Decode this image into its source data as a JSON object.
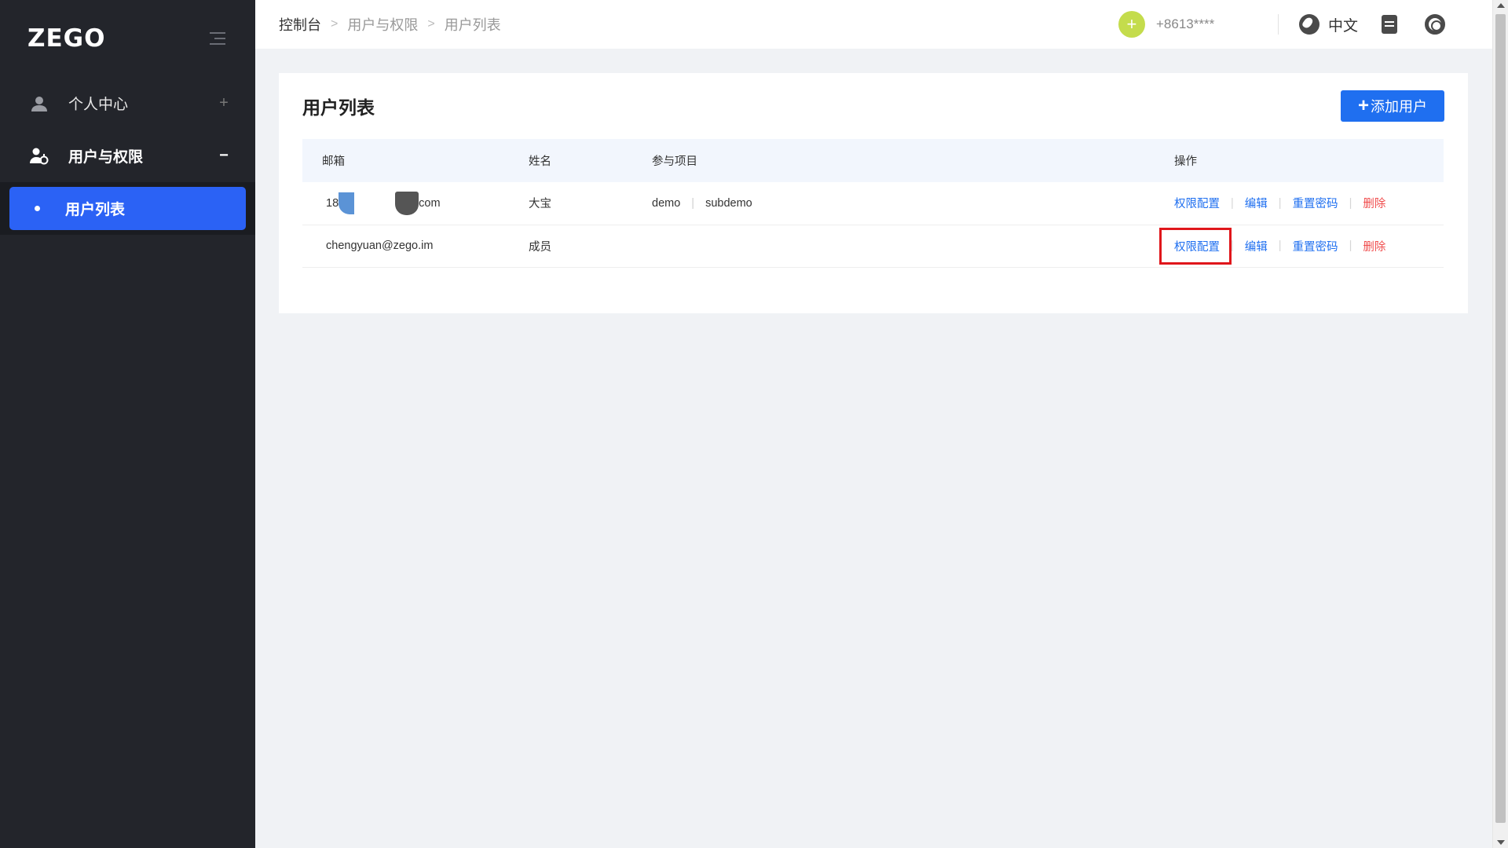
{
  "sidebar": {
    "logo": "ZEGO",
    "menu": [
      {
        "label": "个人中心",
        "toggle": "+"
      },
      {
        "label": "用户与权限",
        "toggle": "−"
      }
    ],
    "submenu": [
      {
        "label": "用户列表"
      }
    ]
  },
  "header": {
    "breadcrumb": [
      "控制台",
      "用户与权限",
      "用户列表"
    ],
    "plus_symbol": "+",
    "phone": "+8613****",
    "language": "中文"
  },
  "card": {
    "title": "用户列表",
    "add_button": "添加用户",
    "add_plus": "+"
  },
  "table": {
    "columns": [
      "邮箱",
      "姓名",
      "参与项目",
      "操作"
    ],
    "rows": [
      {
        "email_prefix": "18",
        "email_suffix": "com",
        "name": "大宝",
        "projects": [
          "demo",
          "subdemo"
        ],
        "ops": [
          "权限配置",
          "编辑",
          "重置密码",
          "删除"
        ]
      },
      {
        "email": "chengyuan@zego.im",
        "name": "成员",
        "projects": [],
        "ops": [
          "权限配置",
          "编辑",
          "重置密码",
          "删除"
        ]
      }
    ]
  },
  "colors": {
    "sidebar_bg": "#23252b",
    "accent": "#1f6ff0",
    "active_menu": "#2b62f5",
    "danger": "#f05050",
    "highlight_border": "#e0161b"
  }
}
